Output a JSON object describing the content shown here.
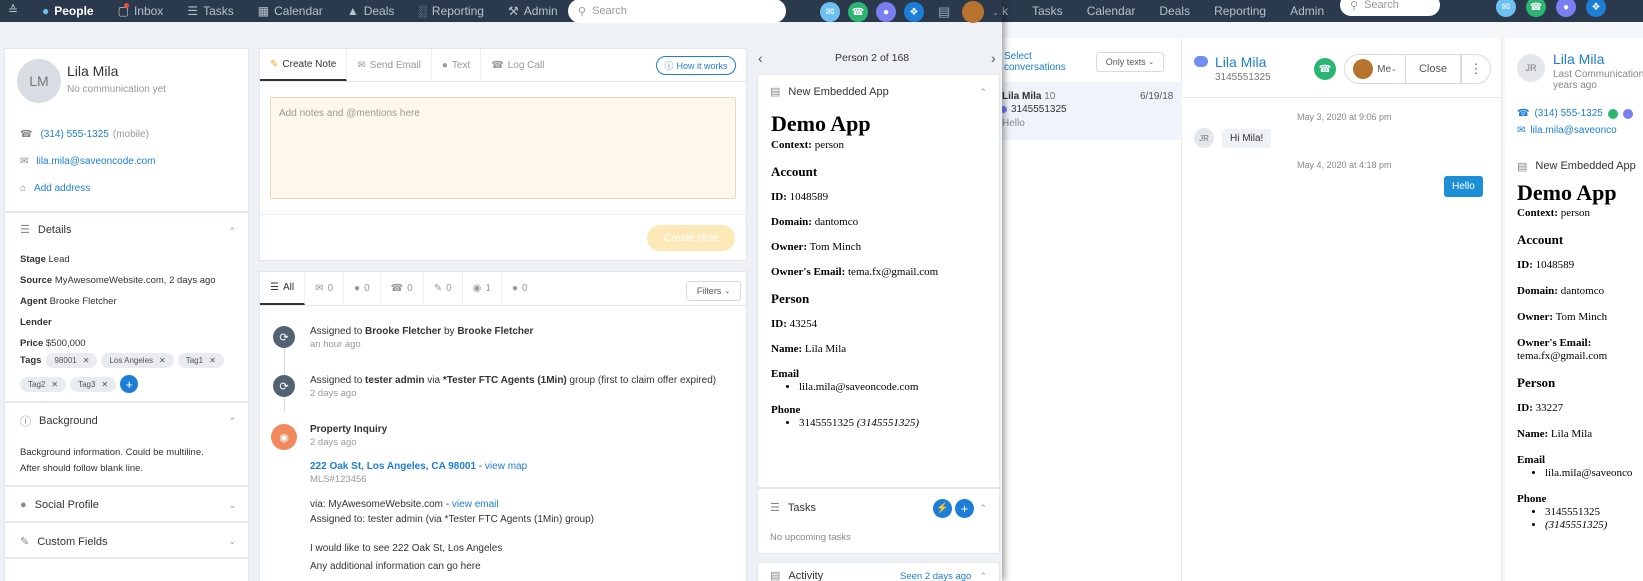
{
  "left_nav": {
    "items": [
      {
        "label": "People",
        "icon": "person-icon",
        "active": true
      },
      {
        "label": "Inbox",
        "icon": "inbox-icon"
      },
      {
        "label": "Tasks",
        "icon": "tasks-icon"
      },
      {
        "label": "Calendar",
        "icon": "calendar-icon"
      },
      {
        "label": "Deals",
        "icon": "deals-icon"
      },
      {
        "label": "Reporting",
        "icon": "reporting-icon"
      },
      {
        "label": "Admin",
        "icon": "admin-icon"
      }
    ],
    "search_placeholder": "Search"
  },
  "right_nav": {
    "items": [
      "k",
      "Tasks",
      "Calendar",
      "Deals",
      "Reporting",
      "Admin"
    ],
    "search_placeholder": "Search"
  },
  "contact": {
    "initials": "LM",
    "name": "Lila Mila",
    "subtitle": "No communication yet",
    "phone": "(314) 555-1325",
    "phone_type": "(mobile)",
    "email": "lila.mila@saveoncode.com",
    "add_address": "Add address"
  },
  "details": {
    "title": "Details",
    "rows": [
      {
        "label": "Stage",
        "value": "Lead"
      },
      {
        "label": "Source",
        "value": "MyAwesomeWebsite.com, 2 days ago"
      },
      {
        "label": "Agent",
        "value": "Brooke Fletcher"
      },
      {
        "label": "Lender",
        "value": ""
      },
      {
        "label": "Price",
        "value": "$500,000"
      }
    ],
    "tags_label": "Tags",
    "tags": [
      "98001",
      "Los Angeles",
      "Tag1",
      "Tag2",
      "Tag3"
    ]
  },
  "background": {
    "title": "Background",
    "line1": "Background information. Could be multiline.",
    "line2": "After should follow blank line."
  },
  "social_profile": "Social Profile",
  "custom_fields": "Custom Fields",
  "composer": {
    "tabs": [
      "Create Note",
      "Send Email",
      "Text",
      "Log Call"
    ],
    "how_it_works": "How it works",
    "placeholder": "Add notes and @mentions here",
    "submit": "Create Note"
  },
  "timeline": {
    "tabs": [
      {
        "label": "All"
      },
      {
        "label": "0"
      },
      {
        "label": "0"
      },
      {
        "label": "0"
      },
      {
        "label": "0"
      },
      {
        "label": "1"
      },
      {
        "label": "0"
      }
    ],
    "filters": "Filters",
    "items": [
      {
        "pre": "Assigned to ",
        "bold1": "Brooke Fletcher",
        "mid": " by ",
        "bold2": "Brooke Fletcher",
        "post": "",
        "time": "an hour ago"
      },
      {
        "pre": "Assigned to ",
        "bold1": "tester admin",
        "mid": " via ",
        "bold2": "*Tester FTC Agents (1Min)",
        "post": " group (first to claim offer expired)",
        "time": "2 days ago"
      }
    ],
    "inquiry": {
      "title": "Property Inquiry",
      "time": "2 days ago",
      "address": "222 Oak St, Los Angeles, CA 98001",
      "map_link": "view map",
      "mls": "MLS#123456",
      "via": "via: MyAwesomeWebsite.com - ",
      "view_email": "view email",
      "assigned": "Assigned to: tester admin (via *Tester FTC Agents (1Min) group)",
      "msg1": "I would like to see 222 Oak St, Los Angeles",
      "msg2": "Any additional information can go here"
    }
  },
  "pager": {
    "label": "Person 2 of 168"
  },
  "embedded": {
    "title": "New Embedded App",
    "app_title": "Demo App",
    "context_label": "Context:",
    "context": "person",
    "account_h": "Account",
    "id_label": "ID:",
    "account_id": "1048589",
    "domain_label": "Domain:",
    "domain": "dantomco",
    "owner_label": "Owner:",
    "owner": "Tom Minch",
    "owner_email_label": "Owner's Email:",
    "owner_email": "tema.fx@gmail.com",
    "person_h": "Person",
    "person_id": "43254",
    "name_label": "Name:",
    "name": "Lila Mila",
    "email_h": "Email",
    "email": "lila.mila@saveoncode.com",
    "phone_h": "Phone",
    "phone": "3145551325",
    "phone_alt": "(3145551325)"
  },
  "tasks": {
    "title": "Tasks",
    "empty": "No upcoming tasks"
  },
  "activity": {
    "title": "Activity",
    "seen": "Seen 2 days ago"
  },
  "inbox": {
    "select": "Select",
    "conversations": "conversations",
    "filter": "Only texts",
    "conv": {
      "name": "Lila Mila",
      "count": "10",
      "date": "6/19/18",
      "phone": "3145551325",
      "preview": "Hello"
    },
    "header": {
      "name": "Lila Mila",
      "phone": "3145551325",
      "me": "Me",
      "close": "Close"
    },
    "messages": [
      {
        "stamp": "May 3, 2020 at 9:06 pm"
      },
      {
        "initials": "JR",
        "text": "Hi Mila!"
      },
      {
        "stamp": "May 4, 2020 at 4:18 pm"
      },
      {
        "text": "Hello"
      }
    ]
  },
  "right_contact": {
    "initials": "JR",
    "name": "Lila Mila",
    "sub1": "Last Communication",
    "sub2": "years ago",
    "phone": "(314) 555-1325",
    "email": "lila.mila@saveonco",
    "app_title_bar": "New Embedded App",
    "app_title": "Demo App",
    "context": "person",
    "account_id": "1048589",
    "domain": "dantomco",
    "owner": "Tom Minch",
    "owner_email": "tema.fx@gmail.com",
    "person_id": "33227",
    "phone_num": "3145551325",
    "phone_alt": "(3145551325)"
  },
  "colors": {
    "nav": "#2a3a4c",
    "accent": "#1c7ed6",
    "note_bg": "#fff8ea",
    "button_disabled": "#fde9b8"
  }
}
